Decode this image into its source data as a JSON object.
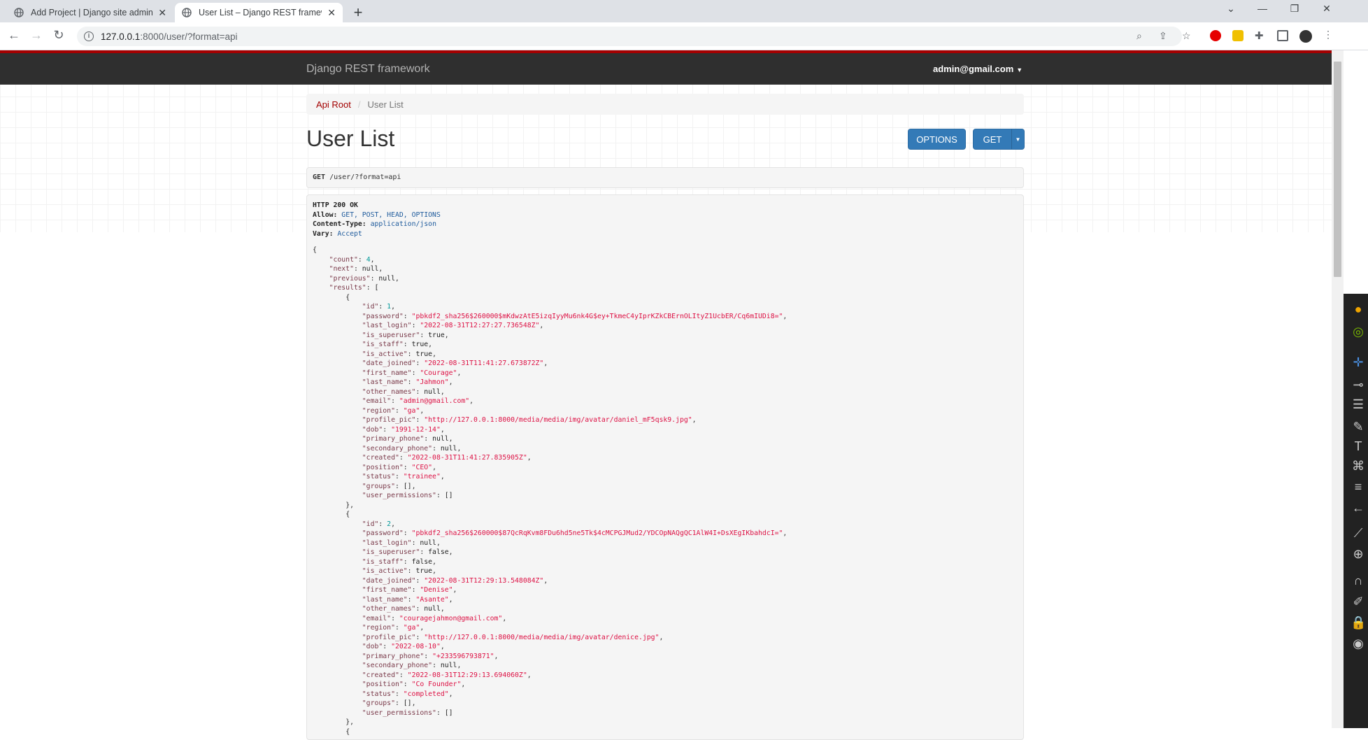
{
  "browser": {
    "tabs": [
      {
        "title": "Add Project | Django site admin",
        "active": false
      },
      {
        "title": "User List – Django REST framewo",
        "active": true
      }
    ],
    "url_host": "127.0.0.1",
    "url_rest": ":8000/user/?format=api"
  },
  "navbar": {
    "brand": "Django REST framework",
    "user": "admin@gmail.com"
  },
  "breadcrumb": {
    "root": "Api Root",
    "separator": "/",
    "current": "User List"
  },
  "page": {
    "title": "User List",
    "options_label": "OPTIONS",
    "get_label": "GET"
  },
  "request": {
    "method": "GET",
    "path": "/user/?format=api"
  },
  "response": {
    "status": "HTTP 200 OK",
    "allow_label": "Allow:",
    "allow_value": "GET, POST, HEAD, OPTIONS",
    "content_type_label": "Content-Type:",
    "content_type_value": "application/json",
    "vary_label": "Vary:",
    "vary_value": "Accept"
  },
  "body": {
    "count": "4",
    "next": "null",
    "previous": "null",
    "users": [
      {
        "id": "1",
        "password": "\"pbkdf2_sha256$260000$mKdwzAtE5izqIyyMu6nk4G$ey+TkmeC4yIprKZkCBErnOLItyZ1UcbER/Cq6mIUDi8=\"",
        "last_login": "\"2022-08-31T12:27:27.736548Z\"",
        "is_superuser": "true",
        "is_staff": "true",
        "is_active": "true",
        "date_joined": "\"2022-08-31T11:41:27.673872Z\"",
        "first_name": "\"Courage\"",
        "last_name": "\"Jahmon\"",
        "other_names": "null",
        "email": "\"admin@gmail.com\"",
        "region": "\"ga\"",
        "profile_pic": "\"http://127.0.0.1:8000/media/media/img/avatar/daniel_mF5qsk9.jpg\"",
        "dob": "\"1991-12-14\"",
        "primary_phone": "null",
        "secondary_phone": "null",
        "created": "\"2022-08-31T11:41:27.835905Z\"",
        "position": "\"CEO\"",
        "status": "\"trainee\"",
        "groups": "[]",
        "user_permissions": "[]"
      },
      {
        "id": "2",
        "password": "\"pbkdf2_sha256$260000$87QcRqKvm8FDu6hd5ne5Tk$4cMCPGJMud2/YDCOpNAQgQC1AlW4I+DsXEgIKbahdcI=\"",
        "last_login": "null",
        "is_superuser": "false",
        "is_staff": "false",
        "is_active": "true",
        "date_joined": "\"2022-08-31T12:29:13.548084Z\"",
        "first_name": "\"Denise\"",
        "last_name": "\"Asante\"",
        "other_names": "null",
        "email": "\"couragejahmon@gmail.com\"",
        "region": "\"ga\"",
        "profile_pic": "\"http://127.0.0.1:8000/media/media/img/avatar/denice.jpg\"",
        "dob": "\"2022-08-10\"",
        "primary_phone": "\"+233596793871\"",
        "secondary_phone": "null",
        "created": "\"2022-08-31T12:29:13.694060Z\"",
        "position": "\"Co Founder\"",
        "status": "\"completed\"",
        "groups": "[]",
        "user_permissions": "[]"
      }
    ]
  },
  "icons": {
    "favicon": "globe-icon",
    "back": "arrow-left-icon",
    "forward": "arrow-right-icon",
    "reload": "reload-icon",
    "zoom": "zoom-icon",
    "share": "share-icon",
    "star": "star-icon",
    "extensions": "puzzle-icon"
  }
}
